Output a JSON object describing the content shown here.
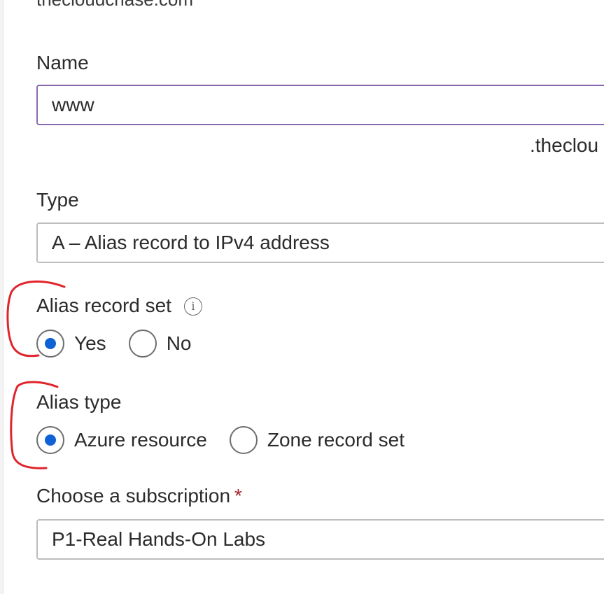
{
  "zone": {
    "name": "thecloudchase.com"
  },
  "name_field": {
    "label": "Name",
    "value": "www",
    "suffix": ".theclou"
  },
  "type_field": {
    "label": "Type",
    "value": "A – Alias record to IPv4 address"
  },
  "alias_record_set": {
    "label": "Alias record set",
    "info_icon": "info-icon",
    "options": [
      {
        "label": "Yes",
        "selected": true
      },
      {
        "label": "No",
        "selected": false
      }
    ]
  },
  "alias_type": {
    "label": "Alias type",
    "options": [
      {
        "label": "Azure resource",
        "selected": true
      },
      {
        "label": "Zone record set",
        "selected": false
      }
    ]
  },
  "subscription": {
    "label": "Choose a subscription",
    "required_marker": "*",
    "value": "P1-Real Hands-On Labs"
  },
  "colors": {
    "accent": "#0f62d6",
    "annotation": "#e0242c",
    "required": "#a4262c",
    "focus_border": "#8a6bb0"
  }
}
